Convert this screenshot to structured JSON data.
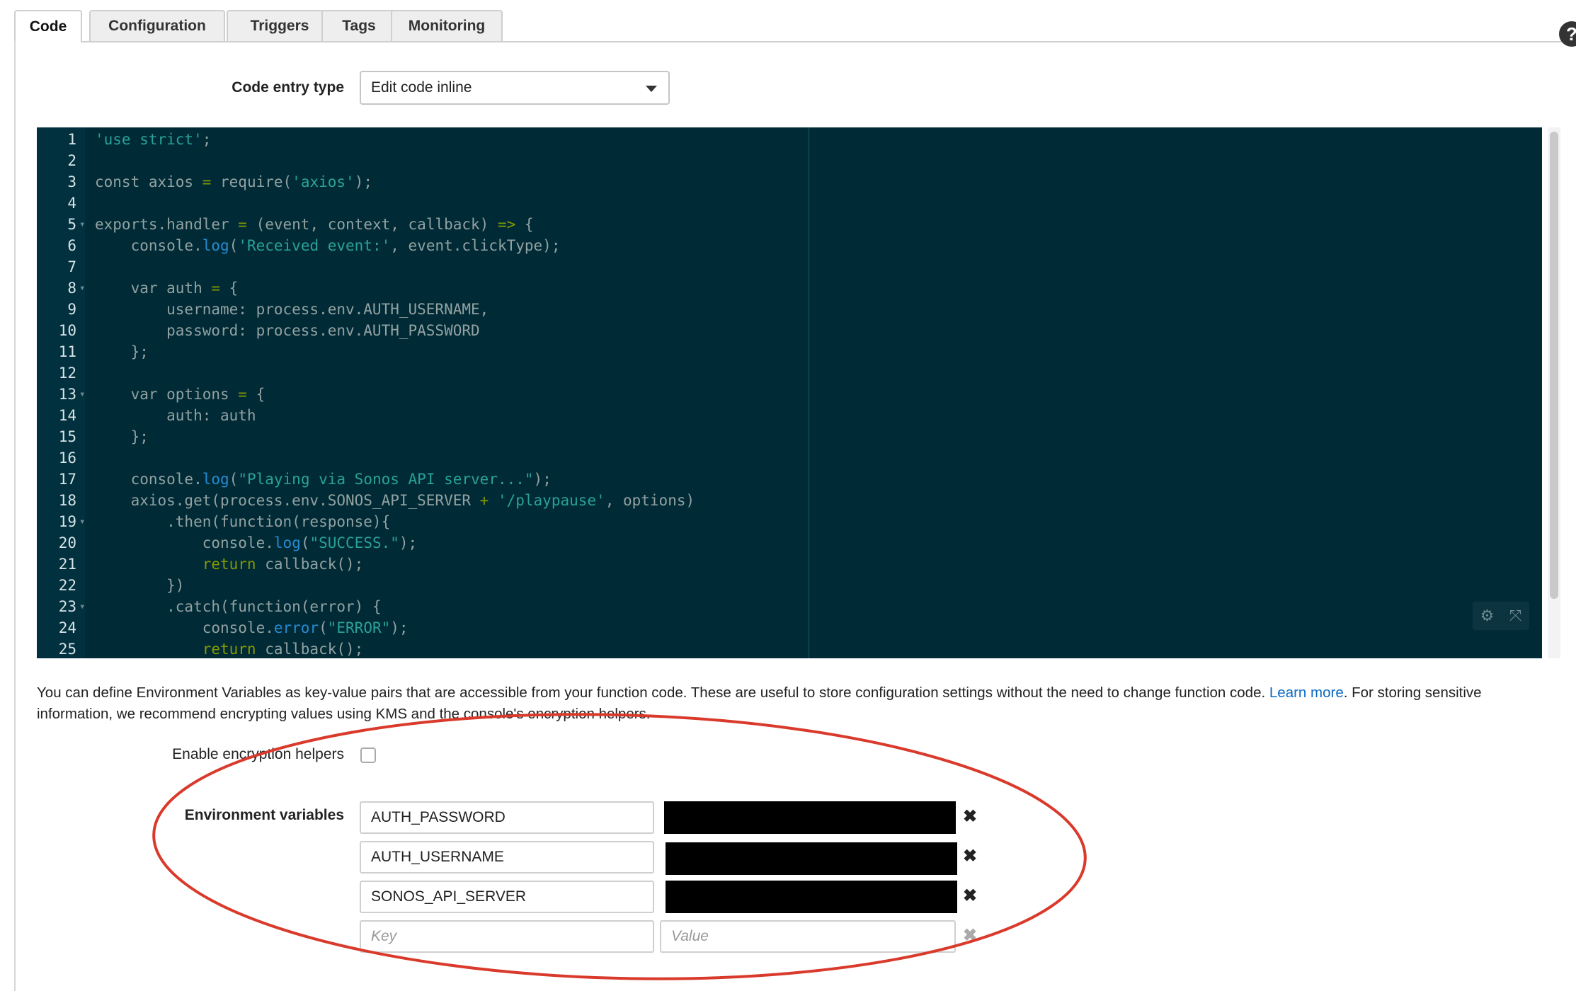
{
  "tabs": [
    "Code",
    "Configuration",
    "Triggers",
    "Tags",
    "Monitoring"
  ],
  "active_tab": "Code",
  "help_icon": "?",
  "code_entry_type": {
    "label": "Code entry type",
    "selected": "Edit code inline"
  },
  "editor": {
    "lines": [
      {
        "n": "1",
        "fold": false,
        "parts": [
          [
            "s",
            "'use strict'"
          ],
          [
            "p",
            ";"
          ]
        ]
      },
      {
        "n": "2",
        "fold": false,
        "parts": []
      },
      {
        "n": "3",
        "fold": false,
        "parts": [
          [
            "p",
            "const axios "
          ],
          [
            "k",
            "="
          ],
          [
            "p",
            " require("
          ],
          [
            "s",
            "'axios'"
          ],
          [
            "p",
            ");"
          ]
        ]
      },
      {
        "n": "4",
        "fold": false,
        "parts": []
      },
      {
        "n": "5",
        "fold": true,
        "parts": [
          [
            "p",
            "exports.handler "
          ],
          [
            "k",
            "="
          ],
          [
            "p",
            " (event, context, callback) "
          ],
          [
            "k",
            "=>"
          ],
          [
            "p",
            " {"
          ]
        ]
      },
      {
        "n": "6",
        "fold": false,
        "parts": [
          [
            "p",
            "    console."
          ],
          [
            "f",
            "log"
          ],
          [
            "p",
            "("
          ],
          [
            "s",
            "'Received event:'"
          ],
          [
            "p",
            ", event.clickType);"
          ]
        ]
      },
      {
        "n": "7",
        "fold": false,
        "parts": []
      },
      {
        "n": "8",
        "fold": true,
        "parts": [
          [
            "p",
            "    var auth "
          ],
          [
            "k",
            "="
          ],
          [
            "p",
            " {"
          ]
        ]
      },
      {
        "n": "9",
        "fold": false,
        "parts": [
          [
            "p",
            "        username: process.env.AUTH_USERNAME,"
          ]
        ]
      },
      {
        "n": "10",
        "fold": false,
        "parts": [
          [
            "p",
            "        password: process.env.AUTH_PASSWORD"
          ]
        ]
      },
      {
        "n": "11",
        "fold": false,
        "parts": [
          [
            "p",
            "    };"
          ]
        ]
      },
      {
        "n": "12",
        "fold": false,
        "parts": []
      },
      {
        "n": "13",
        "fold": true,
        "parts": [
          [
            "p",
            "    var options "
          ],
          [
            "k",
            "="
          ],
          [
            "p",
            " {"
          ]
        ]
      },
      {
        "n": "14",
        "fold": false,
        "parts": [
          [
            "p",
            "        auth: auth"
          ]
        ]
      },
      {
        "n": "15",
        "fold": false,
        "parts": [
          [
            "p",
            "    };"
          ]
        ]
      },
      {
        "n": "16",
        "fold": false,
        "parts": []
      },
      {
        "n": "17",
        "fold": false,
        "parts": [
          [
            "p",
            "    console."
          ],
          [
            "f",
            "log"
          ],
          [
            "p",
            "("
          ],
          [
            "s",
            "\"Playing via Sonos API server...\""
          ],
          [
            "p",
            ");"
          ]
        ]
      },
      {
        "n": "18",
        "fold": false,
        "parts": [
          [
            "p",
            "    axios.get(process.env.SONOS_API_SERVER "
          ],
          [
            "k",
            "+"
          ],
          [
            "p",
            " "
          ],
          [
            "s",
            "'/playpause'"
          ],
          [
            "p",
            ", options)"
          ]
        ]
      },
      {
        "n": "19",
        "fold": true,
        "parts": [
          [
            "p",
            "        .then(function(response){"
          ]
        ]
      },
      {
        "n": "20",
        "fold": false,
        "parts": [
          [
            "p",
            "            console."
          ],
          [
            "f",
            "log"
          ],
          [
            "p",
            "("
          ],
          [
            "s",
            "\"SUCCESS.\""
          ],
          [
            "p",
            ");"
          ]
        ]
      },
      {
        "n": "21",
        "fold": false,
        "parts": [
          [
            "k",
            "            return"
          ],
          [
            "p",
            " callback();"
          ]
        ]
      },
      {
        "n": "22",
        "fold": false,
        "parts": [
          [
            "p",
            "        })"
          ]
        ]
      },
      {
        "n": "23",
        "fold": true,
        "parts": [
          [
            "p",
            "        .catch(function(error) {"
          ]
        ]
      },
      {
        "n": "24",
        "fold": false,
        "parts": [
          [
            "p",
            "            console."
          ],
          [
            "f",
            "error"
          ],
          [
            "p",
            "("
          ],
          [
            "s",
            "\"ERROR\""
          ],
          [
            "p",
            ");"
          ]
        ]
      },
      {
        "n": "25",
        "fold": false,
        "parts": [
          [
            "k",
            "            return"
          ],
          [
            "p",
            " callback();"
          ]
        ]
      }
    ],
    "tools": {
      "settings_icon": "⚙",
      "fullscreen_icon": "⤧"
    }
  },
  "env_description": {
    "text_before": "You can define Environment Variables as key-value pairs that are accessible from your function code. These are useful to store configuration settings without the need to change function code. ",
    "link": "Learn more",
    "text_after": ". For storing sensitive information, we recommend encrypting values using KMS and the console's encryption helpers."
  },
  "encryption_helpers_label": "Enable encryption helpers",
  "environment_variables": {
    "label": "Environment variables",
    "rows": [
      {
        "key": "AUTH_PASSWORD"
      },
      {
        "key": "AUTH_USERNAME"
      },
      {
        "key": "SONOS_API_SERVER"
      }
    ],
    "new_key_placeholder": "Key",
    "new_value_placeholder": "Value",
    "remove_icon": "✖"
  },
  "colors": {
    "editor_bg": "#002b36",
    "annotation": "#d93a2b",
    "link": "#0a6ac2"
  }
}
